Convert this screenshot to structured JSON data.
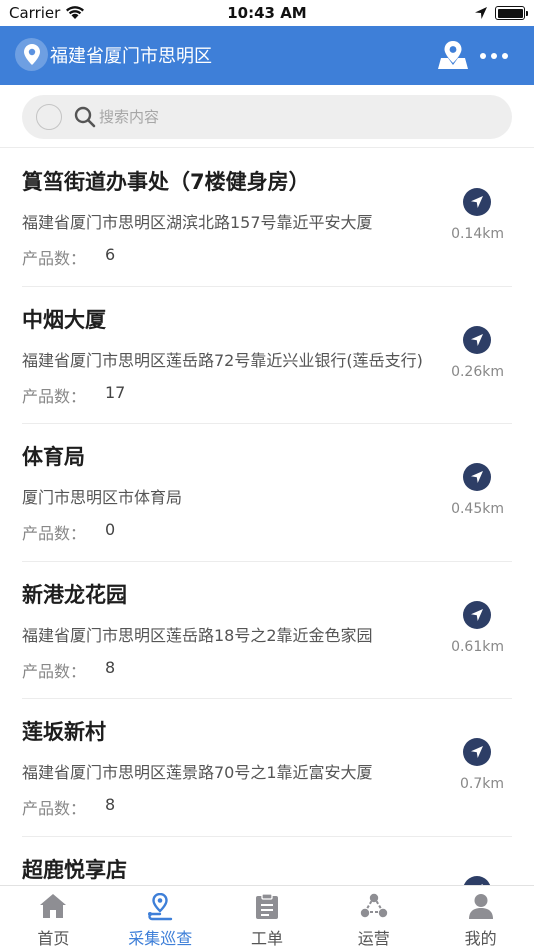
{
  "status_bar": {
    "carrier": "Carrier",
    "time": "10:43 AM"
  },
  "header": {
    "location": "福建省厦门市思明区"
  },
  "search": {
    "placeholder": "搜索内容"
  },
  "list": {
    "count_label": "产品数：",
    "items": [
      {
        "name": "篔筜街道办事处（7楼健身房）",
        "address": "福建省厦门市思明区湖滨北路157号靠近平安大厦",
        "count": "6",
        "distance": "0.14km"
      },
      {
        "name": "中烟大厦",
        "address": "福建省厦门市思明区莲岳路72号靠近兴业银行(莲岳支行)",
        "count": "17",
        "distance": "0.26km"
      },
      {
        "name": "体育局",
        "address": "厦门市思明区市体育局",
        "count": "0",
        "distance": "0.45km"
      },
      {
        "name": "新港龙花园",
        "address": "福建省厦门市思明区莲岳路18号之2靠近金色家园",
        "count": "8",
        "distance": "0.61km"
      },
      {
        "name": "莲坂新村",
        "address": "福建省厦门市思明区莲景路70号之1靠近富安大厦",
        "count": "8",
        "distance": "0.7km"
      },
      {
        "name": "超鹿悦享店",
        "address": "",
        "count": "",
        "distance": ""
      }
    ]
  },
  "tabbar": {
    "active_color": "#3e7fd8",
    "tabs": [
      {
        "label": "首页",
        "icon": "home-icon"
      },
      {
        "label": "采集巡查",
        "icon": "route-pin-icon"
      },
      {
        "label": "工单",
        "icon": "clipboard-icon"
      },
      {
        "label": "运营",
        "icon": "share-nodes-icon"
      },
      {
        "label": "我的",
        "icon": "user-icon"
      }
    ]
  },
  "colors": {
    "header_bg": "#3e7fd8",
    "nav_button": "#2d3e66"
  }
}
